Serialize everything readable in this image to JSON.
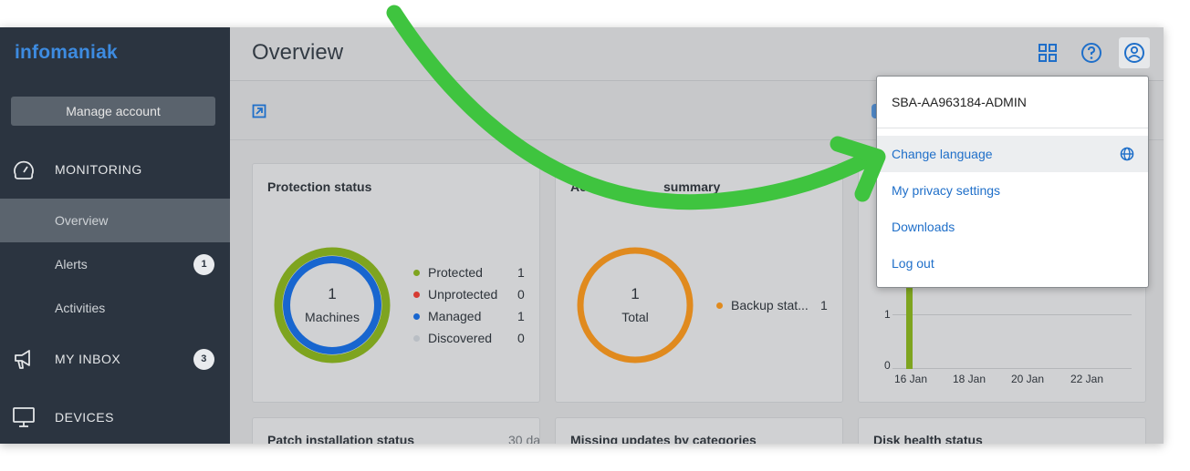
{
  "sidebar": {
    "logo": "infomaniak",
    "manage_account": "Manage account",
    "monitoring": "MONITORING",
    "items": [
      {
        "label": "Overview"
      },
      {
        "label": "Alerts",
        "badge": "1"
      },
      {
        "label": "Activities"
      }
    ],
    "inbox": {
      "label": "MY INBOX",
      "badge": "3"
    },
    "devices": "DEVICES"
  },
  "header": {
    "title": "Overview"
  },
  "cards": {
    "protection": {
      "title": "Protection status",
      "center_value": "1",
      "center_label": "Machines",
      "legend": [
        {
          "label": "Protected",
          "count": "1",
          "color": "#7ea41f"
        },
        {
          "label": "Unprotected",
          "count": "0",
          "color": "#d63b32"
        },
        {
          "label": "Managed",
          "count": "1",
          "color": "#1866cf"
        },
        {
          "label": "Discovered",
          "count": "0",
          "color": "#b9bec4"
        }
      ]
    },
    "activities": {
      "title_start": "Active",
      "title_end": "summary",
      "center_value": "1",
      "center_label": "Total",
      "legend": [
        {
          "label": "Backup stat...",
          "count": "1",
          "color": "#e08a1e"
        }
      ]
    },
    "history": {
      "y_ticks": [
        "1",
        "0"
      ],
      "x_ticks": [
        "16 Jan",
        "18 Jan",
        "20 Jan",
        "22 Jan"
      ]
    },
    "bottom": [
      {
        "title": "Patch installation status",
        "extra": "30 da"
      },
      {
        "title": "Missing updates by categories"
      },
      {
        "title": "Disk health status"
      }
    ]
  },
  "menu": {
    "user": "SBA-AA963184-ADMIN",
    "items": [
      {
        "label": "Change language"
      },
      {
        "label": "My privacy settings"
      },
      {
        "label": "Downloads"
      },
      {
        "label": "Log out"
      }
    ]
  }
}
